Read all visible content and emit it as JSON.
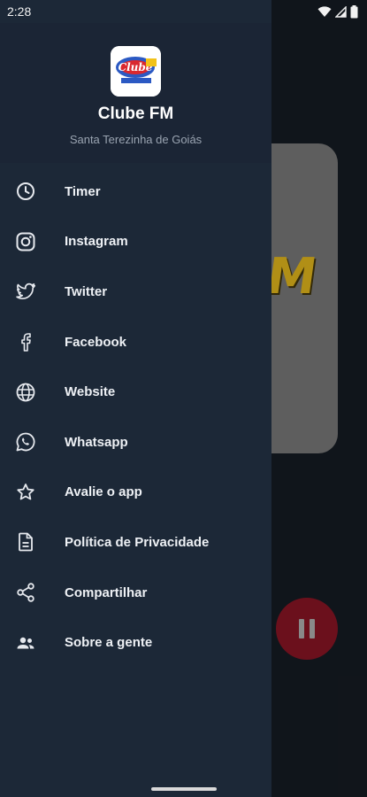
{
  "status_bar": {
    "time": "2:28"
  },
  "background": {
    "card_text": "M"
  },
  "drawer": {
    "app_name": "Clube FM",
    "subtitle": "Santa Terezinha de Goiás",
    "logo_text": "Clube"
  },
  "menu": [
    {
      "icon": "clock-icon",
      "label": "Timer"
    },
    {
      "icon": "instagram-icon",
      "label": "Instagram"
    },
    {
      "icon": "twitter-icon",
      "label": "Twitter"
    },
    {
      "icon": "facebook-icon",
      "label": "Facebook"
    },
    {
      "icon": "globe-icon",
      "label": "Website"
    },
    {
      "icon": "whatsapp-icon",
      "label": "Whatsapp"
    },
    {
      "icon": "star-icon",
      "label": "Avalie o app"
    },
    {
      "icon": "document-icon",
      "label": "Política de Privacidade"
    },
    {
      "icon": "share-icon",
      "label": "Compartilhar"
    },
    {
      "icon": "people-icon",
      "label": "Sobre a gente"
    }
  ],
  "colors": {
    "drawer_bg": "#1c2837",
    "icon_color": "#e6e9ee",
    "play_button": "#7a1320"
  }
}
